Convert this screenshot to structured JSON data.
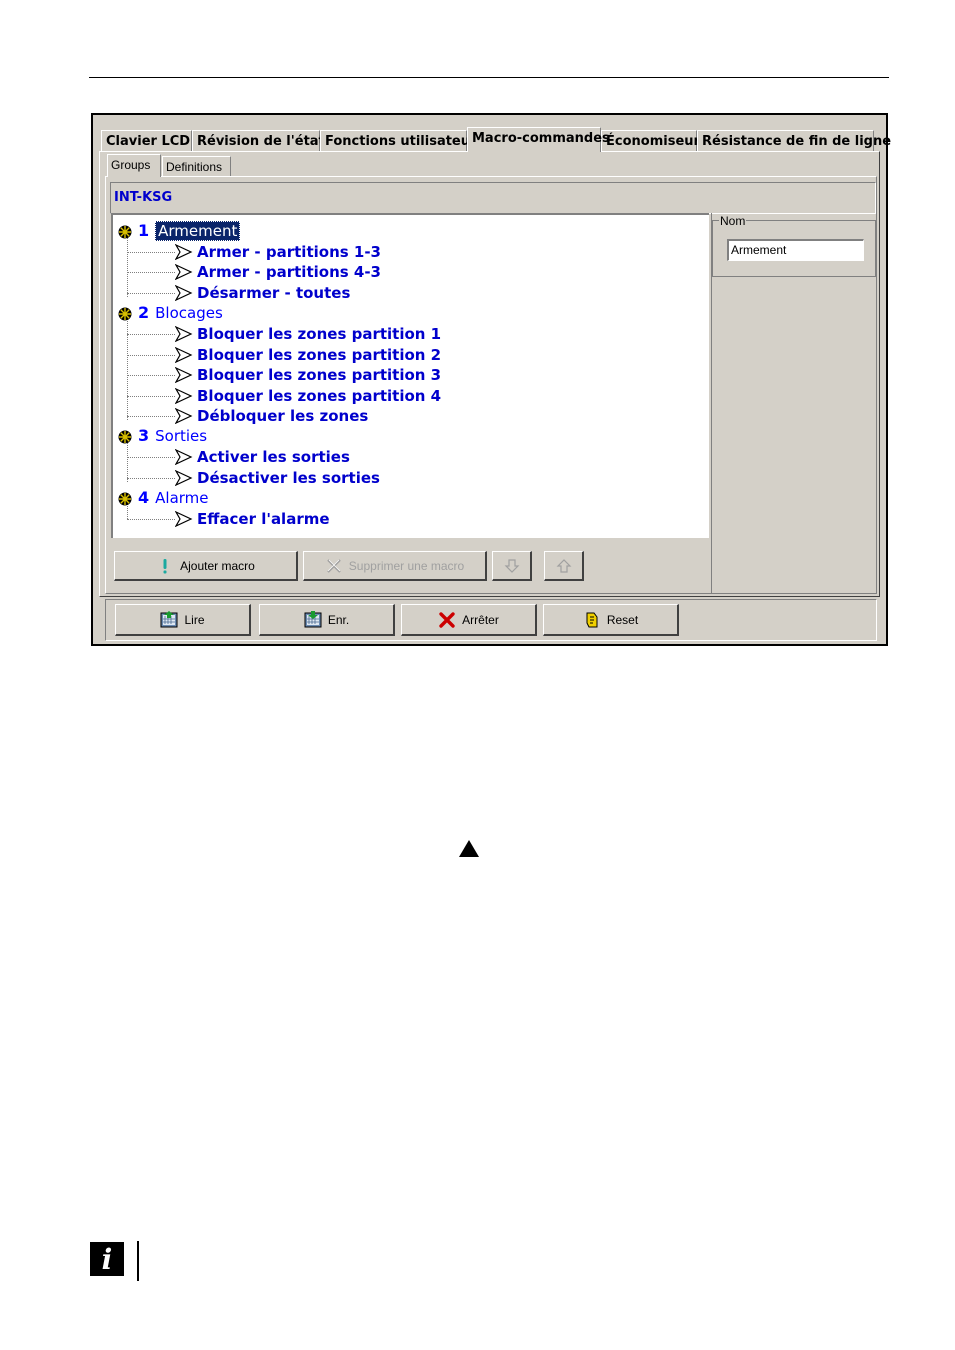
{
  "tabs": [
    {
      "label": "Clavier LCD",
      "active": false
    },
    {
      "label": "Révision de l'état",
      "active": false
    },
    {
      "label": "Fonctions utilisateur",
      "active": false
    },
    {
      "label": "Macro-commandes",
      "active": true
    },
    {
      "label": "Économiseur",
      "active": false
    },
    {
      "label": "Résistance de fin de ligne",
      "active": false
    }
  ],
  "subtabs": [
    {
      "label": "Groups",
      "active": true
    },
    {
      "label": "Definitions",
      "active": false
    }
  ],
  "module_name": "INT-KSG",
  "tree": {
    "groups": [
      {
        "number": "1",
        "name": "Armement",
        "selected": true,
        "items": [
          "Armer - partitions 1-3",
          "Armer - partitions 4-3",
          "Désarmer - toutes"
        ]
      },
      {
        "number": "2",
        "name": "Blocages",
        "selected": false,
        "items": [
          "Bloquer les zones partition 1",
          "Bloquer les zones partition 2",
          "Bloquer les zones partition 3",
          "Bloquer les zones partition 4",
          "Débloquer les zones"
        ]
      },
      {
        "number": "3",
        "name": "Sorties",
        "selected": false,
        "items": [
          "Activer les sorties",
          "Désactiver les sorties"
        ]
      },
      {
        "number": "4",
        "name": "Alarme",
        "selected": false,
        "items": [
          "Effacer l'alarme"
        ]
      }
    ]
  },
  "nom": {
    "label": "Nom",
    "value": "Armement"
  },
  "macro_buttons": {
    "add": {
      "label": "Ajouter macro",
      "icon": "exclamation-icon"
    },
    "delete": {
      "label": "Supprimer une macro",
      "icon": "cross-icon",
      "disabled": true
    },
    "down": {
      "icon": "arrow-down-icon",
      "disabled": true
    },
    "up": {
      "icon": "arrow-up-icon",
      "disabled": true
    }
  },
  "bottom_buttons": {
    "read": {
      "label": "Lire",
      "icon": "read-icon"
    },
    "write": {
      "label": "Enr.",
      "icon": "write-icon"
    },
    "stop": {
      "label": "Arrêter",
      "icon": "stop-icon"
    },
    "reset": {
      "label": "Reset",
      "icon": "reset-icon"
    }
  },
  "colors": {
    "window_bg": "#d4d0c8",
    "tree_text": "#0000ff",
    "selection_bg": "#0a246a",
    "stop_red": "#cc0000"
  }
}
